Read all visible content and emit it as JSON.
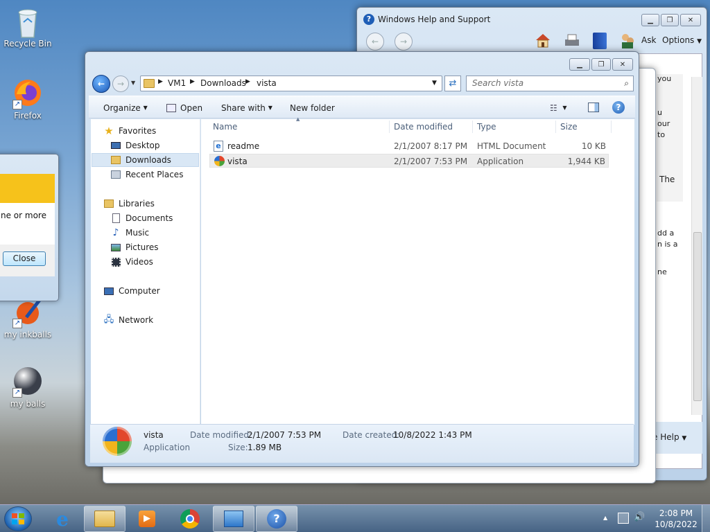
{
  "desktop": {
    "icons": [
      {
        "label": "Recycle Bin"
      },
      {
        "label": "Firefox"
      },
      {
        "label": "my inkballs"
      },
      {
        "label": "my balls"
      }
    ]
  },
  "dialog": {
    "text": "ne or more",
    "close_label": "Close"
  },
  "help_window": {
    "title": "Windows Help and Support",
    "ask_label": "Ask",
    "options_label": "Options",
    "help_label": "e Help",
    "side_text": [
      "you",
      "u",
      "our",
      "to",
      "The",
      "dd a",
      "n is a",
      "ne"
    ]
  },
  "explorer": {
    "breadcrumb": [
      "VM1",
      "Downloads",
      "vista"
    ],
    "search_placeholder": "Search vista",
    "toolbar": {
      "organize": "Organize",
      "open": "Open",
      "share_with": "Share with",
      "new_folder": "New folder"
    },
    "nav": {
      "favorites": "Favorites",
      "desktop": "Desktop",
      "downloads": "Downloads",
      "recent_places": "Recent Places",
      "libraries": "Libraries",
      "documents": "Documents",
      "music": "Music",
      "pictures": "Pictures",
      "videos": "Videos",
      "computer": "Computer",
      "network": "Network"
    },
    "columns": {
      "name": "Name",
      "date_modified": "Date modified",
      "type": "Type",
      "size": "Size"
    },
    "files": [
      {
        "name": "readme",
        "date": "2/1/2007 8:17 PM",
        "type": "HTML Document",
        "size": "10 KB"
      },
      {
        "name": "vista",
        "date": "2/1/2007 7:53 PM",
        "type": "Application",
        "size": "1,944 KB"
      }
    ],
    "details": {
      "name": "vista",
      "type": "Application",
      "date_modified_label": "Date modified:",
      "date_modified": "2/1/2007 7:53 PM",
      "date_created_label": "Date created:",
      "date_created": "10/8/2022 1:43 PM",
      "size_label": "Size:",
      "size": "1.89 MB"
    }
  },
  "taskbar": {
    "time": "2:08 PM",
    "date": "10/8/2022"
  }
}
